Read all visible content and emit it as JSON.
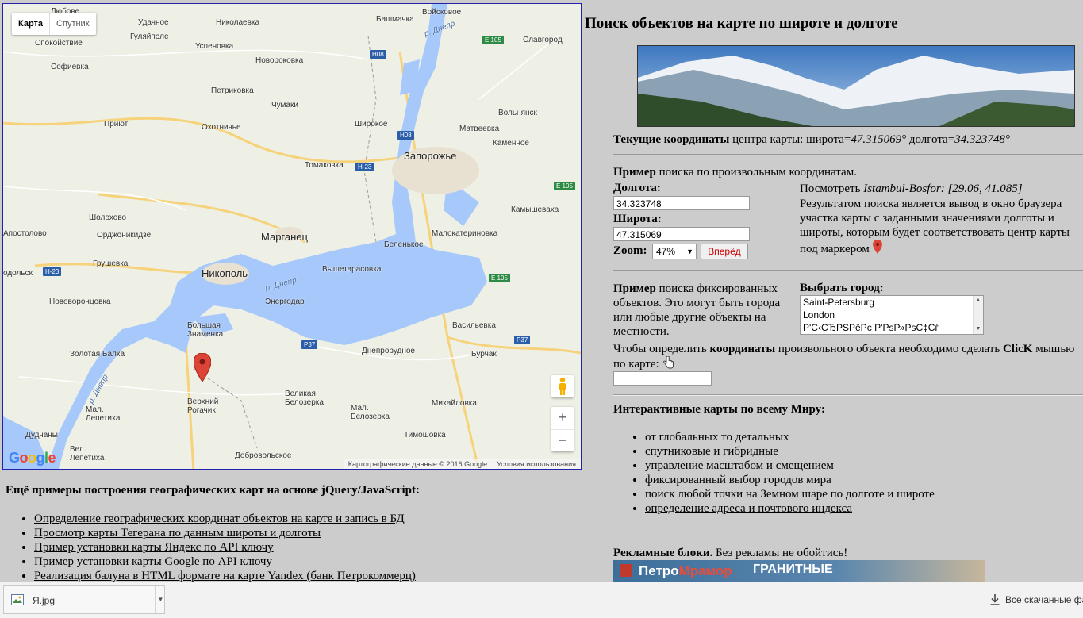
{
  "map": {
    "map_type_buttons": [
      "Карта",
      "Спутник"
    ],
    "attribution": "Картографические данные © 2016 Google",
    "terms": "Условия использования",
    "google_logo": "Google",
    "zoom_in": "+",
    "zoom_out": "−",
    "marker_color": "#db4437",
    "water_color": "#a6c8fa",
    "towns": {
      "lyubov": "Любове",
      "udachnoe": "Удачное",
      "gulyaypole": "Гуляйполе",
      "spokoystvie": "Спокойствие",
      "sofievka": "Софиевка",
      "uspenovka": "Успеновка",
      "nikolaevka": "Николаевка",
      "novorozhkovka": "Новороковка",
      "bashmachka": "Башмачка",
      "voyskovoe": "Войсковое",
      "slavgorod": "Славгород",
      "petrikovka": "Петриковка",
      "chumaki": "Чумаки",
      "volnyansk": "Вольнянск",
      "priyut": "Приют",
      "okhotniche": "Охотничье",
      "shirokoe": "Широкое",
      "matveevka": "Матвеевка",
      "kamenoe": "Каменное",
      "zaporozhye": "Запорожье",
      "tomakovka": "Томаковка",
      "sholokhovo": "Шолохово",
      "ordzhonikidze": "Орджоникидзе",
      "kamyshevakha": "Камышеваха",
      "apostolovo": "Апостолово",
      "marganets": "Марганец",
      "malokaterinovka": "Малокатериновка",
      "gruschevka": "Грушевка",
      "belenkoe": "Беленькое",
      "odolsk": "одольск",
      "nikopol": "Никополь",
      "vyshetarasovka": "Вышетарасовка",
      "novovorontsovka": "Нововоронцовка",
      "energodar": "Энергодар",
      "vasilevka": "Васильевка",
      "bolshaya_znamenka": "Большая\nЗнаменка",
      "zolotaya_balka": "Золотая Балка",
      "dneprorudnoe": "Днепрорудное",
      "burchak": "Бурчак",
      "velikaya_belozerka": "Великая\nБелозерка",
      "mal_belozerka": "Мал.\nБелозерка",
      "verkhniy_rogachik": "Верхний\nРогачик",
      "mal_lepetikha": "Мал.\nЛепетиха",
      "mikhaylovka": "Михайловка",
      "dudchany": "Дудчаны",
      "timoshovka": "Тимошовка",
      "dobrovolskoe": "Добровольское",
      "vel_lepetikha": "Вел.\nЛепетиха"
    },
    "rivers": {
      "dnepr_top": "р. Днепр",
      "dnepr_mid": "р. Днепр",
      "dnepr_low": "р. Днепр"
    },
    "shields": {
      "h08_a": "H08",
      "h08_b": "H08",
      "e105_a": "E 105",
      "e105_b": "E 105",
      "e105_c": "E 105",
      "h23_a": "H-23",
      "h23_b": "H-23",
      "p37_a": "P37",
      "p37_b": "P37"
    }
  },
  "page": {
    "title": "Поиск объектов на карте по широте и долготе",
    "current_coords": {
      "bold": "Текущие координаты",
      "text": " центра карты: широта=",
      "lat": "47.315069°",
      "lon_label": " долгота=",
      "lon": "34.323748°"
    },
    "example": {
      "bold": "Пример",
      "text": " поиска по произвольным координатам."
    },
    "longitude_label": "Долгота:",
    "longitude_value": "34.323748",
    "latitude_label": "Широта:",
    "latitude_value": "47.315069",
    "zoom_label": "Zoom:",
    "zoom_value": "47%",
    "go_button": "Вперёд",
    "view_example": {
      "text": "Посмотреть ",
      "name": "Istambul-Bosfor: [29.06, 41.085]"
    },
    "result_text": "Результатом поиска является вывод в окно браузера участка карты с заданными значениями долготы и широты, которым будет соответствовать центр карты под маркером",
    "fixed_example": {
      "bold": "Пример",
      "text": " поиска фиксированных объектов. Это могут быть города или любые другие объекты на местности."
    },
    "choose_city_label": "Выбрать город:",
    "cities": [
      "Saint-Petersburg",
      "London",
      "Р'С‹СЂРЅРёРє Р'РѕР»РѕС‡Сѓ"
    ],
    "click_hint": {
      "text1": "Чтобы определить ",
      "bold1": "координаты",
      "text2": " произвольного объекта необходимо сделать ",
      "bold2": "ClicK",
      "text3": " мышью по карте:"
    },
    "click_input_value": "",
    "interactive_title": "Интерактивные карты по всему Миру:",
    "features": [
      "от глобальных то детальных",
      "спутниковые и гибридные",
      "управление масштабом и смещением",
      "фиксированный выбор городов мира",
      "поиск любой точки на Земном шаре по долготе и широте"
    ],
    "feature_link": "определение адреса и почтового индекса",
    "ads": {
      "bold": "Рекламные блоки.",
      "text": " Без рекламы не обойтись!",
      "banner_brand_a": "Петро",
      "banner_brand_b": "Мрамор",
      "banner_text": "ГРАНИТНЫЕ"
    },
    "more_examples_title": "Ещё примеры построения географических карт на основе jQuery/JavaScript:",
    "more_links": [
      "Определение географических координат объектов на карте и запись в БД",
      "Просмотр карты Тегерана по данным широты и долготы",
      "Пример установки карты Яндекс по API ключу",
      "Пример установки карты Google по API ключу",
      "Реализация балуна в HTML формате на карте Yandex (банк Петрокоммерц)"
    ]
  },
  "download_bar": {
    "file_name": "Я.jpg",
    "all_downloads": "Все скачанные фа"
  }
}
